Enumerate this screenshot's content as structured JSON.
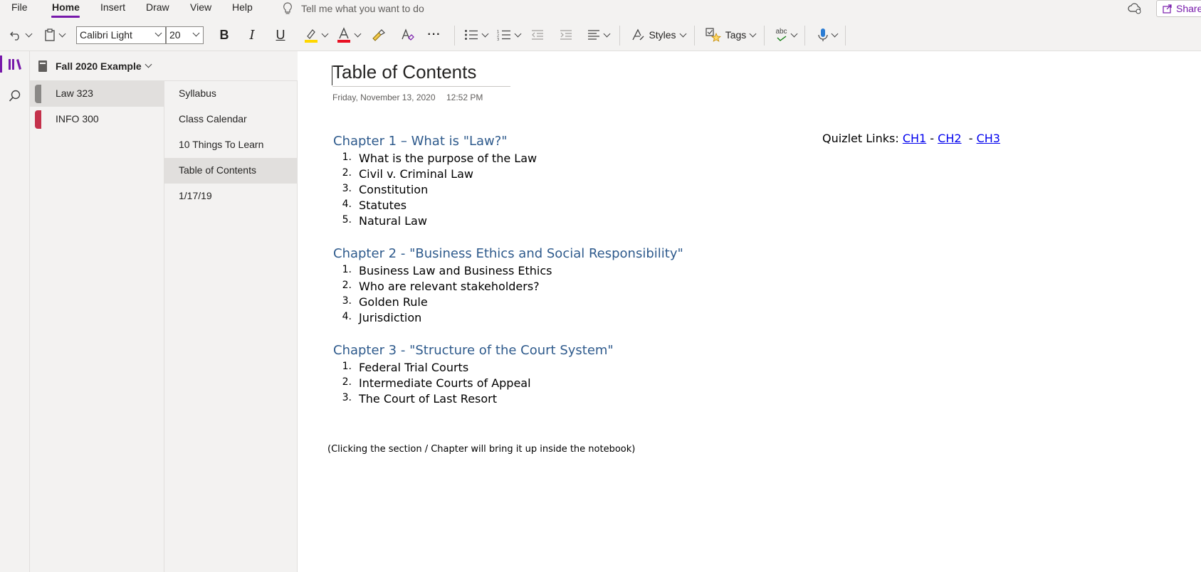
{
  "menu": {
    "items": [
      "File",
      "Home",
      "Insert",
      "Draw",
      "View",
      "Help"
    ],
    "active": "Home",
    "tell_me_placeholder": "Tell me what you want to do",
    "share_label": "Share"
  },
  "toolbar": {
    "font_name": "Calibri Light",
    "font_size": "20",
    "bold": "B",
    "italic": "I",
    "underline": "U",
    "styles_label": "Styles",
    "tags_label": "Tags",
    "spelling_glyph": "abc",
    "more_glyph": "···"
  },
  "notebook": {
    "name": "Fall 2020 Example",
    "sections": [
      {
        "label": "Law 323",
        "color": "#8a8886",
        "selected": true
      },
      {
        "label": "INFO 300",
        "color": "#c4314b",
        "selected": false
      }
    ],
    "pages": [
      {
        "label": "Syllabus",
        "selected": false
      },
      {
        "label": "Class Calendar",
        "selected": false
      },
      {
        "label": "10 Things To Learn",
        "selected": false
      },
      {
        "label": "Table of Contents",
        "selected": true
      },
      {
        "label": "1/17/19",
        "selected": false
      }
    ]
  },
  "page": {
    "title": "Table of Contents",
    "date": "Friday, November 13, 2020",
    "time": "12:52 PM",
    "chapters": [
      {
        "heading": "Chapter 1 – What is \"Law?\"",
        "items": [
          "What is the purpose of the Law",
          "Civil v. Criminal Law",
          "Constitution",
          "Statutes",
          "Natural Law"
        ]
      },
      {
        "heading": "Chapter 2 - \"Business Ethics and Social Responsibility\"",
        "items": [
          "Business Law and Business Ethics",
          "Who are relevant stakeholders?",
          "Golden Rule",
          "Jurisdiction"
        ]
      },
      {
        "heading": "Chapter 3 - \"Structure of the Court System\"",
        "items": [
          "Federal Trial Courts",
          "Intermediate Courts of Appeal",
          "The Court of Last Resort"
        ]
      }
    ],
    "quizlet": {
      "prefix": "Quizlet Links: ",
      "links": [
        "CH1",
        "CH2",
        "CH3"
      ],
      "sep1": " - ",
      "sep2": "  - "
    },
    "footnote": "(Clicking the section / Chapter will bring it up inside the notebook)"
  },
  "colors": {
    "accent": "#7719aa",
    "heading": "#2e5a8c",
    "link": "#0000ee"
  }
}
